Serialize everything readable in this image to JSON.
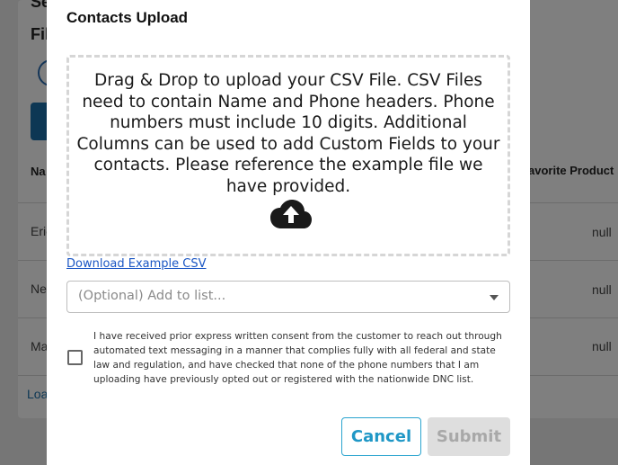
{
  "background": {
    "title_partial_1": "Se",
    "title_partial_2": "Fil",
    "column_name_partial": "Na",
    "column_favorite_partial": "avorite Product",
    "rows": [
      {
        "name_partial": "Eric",
        "favorite": "null"
      },
      {
        "name_partial": "Nev",
        "favorite": "null"
      },
      {
        "name_partial": "Ma",
        "favorite": "null"
      }
    ],
    "link_partial": "Loa"
  },
  "modal": {
    "title": "Contacts Upload",
    "dropzone_text": "Drag & Drop to upload your CSV File. CSV Files need to contain Name and Phone headers. Phone numbers must include 10 digits. Additional Columns can be used to add Custom Fields to your contacts. Please reference the example file we have provided.",
    "dropzone_icon": "cloud-upload-icon",
    "download_link": "Download Example CSV",
    "list_select_placeholder": "(Optional) Add to list...",
    "consent_checked": false,
    "consent_text": "I have received prior express written consent from the customer to reach out through automated text messaging in a manner that complies fully with all federal and state law and regulation, and have checked that none of the phone numbers that I am uploading have previously opted out or registered with the nationwide DNC list.",
    "cancel_label": "Cancel",
    "submit_label": "Submit",
    "submit_enabled": false
  },
  "colors": {
    "accent": "#1f97c6",
    "link": "#1a56c4",
    "disabled_bg": "#dedede",
    "disabled_text": "#a8a8a8",
    "overlay": "rgba(0,0,0,0.5)"
  }
}
